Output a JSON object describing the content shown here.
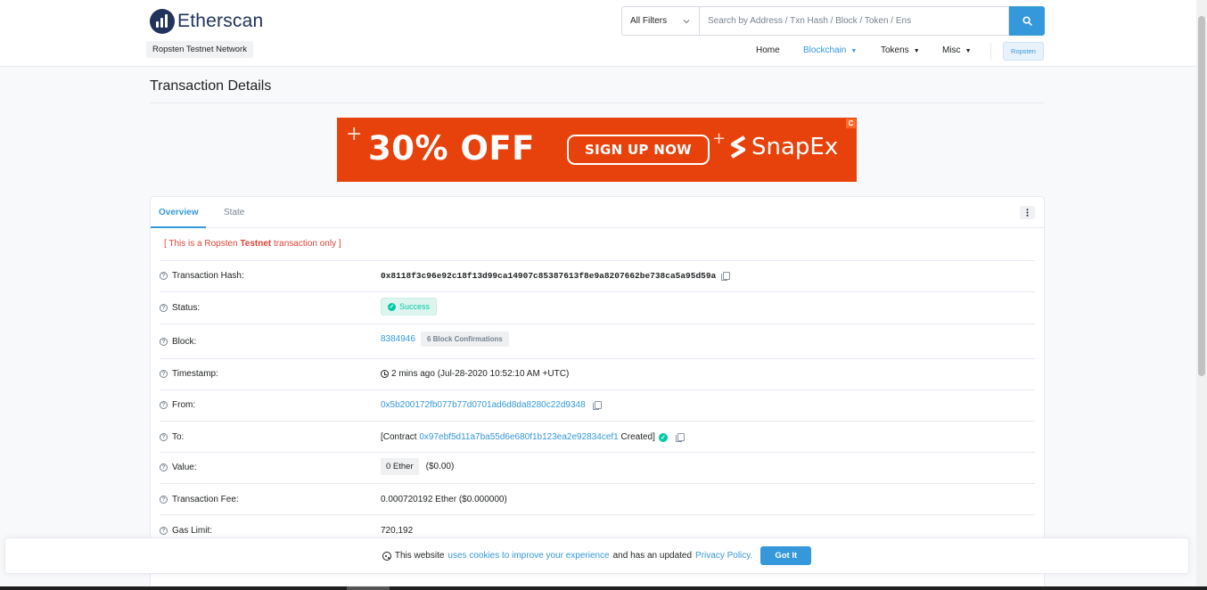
{
  "brand": {
    "name": "Etherscan",
    "network": "Ropsten Testnet Network"
  },
  "search": {
    "filter_label": "All Filters",
    "placeholder": "Search by Address / Txn Hash / Block / Token / Ens"
  },
  "nav": {
    "home": "Home",
    "blockchain": "Blockchain",
    "tokens": "Tokens",
    "misc": "Misc",
    "network_button": "Ropsten"
  },
  "page": {
    "title": "Transaction Details"
  },
  "ad": {
    "offer": "30% OFF",
    "cta": "SIGN UP NOW",
    "brand": "SnapEx",
    "corner": "C",
    "color": "#e8420c"
  },
  "tabs": {
    "overview": "Overview",
    "state": "State"
  },
  "notice": {
    "prefix": "[ This is a Ropsten ",
    "bold": "Testnet",
    "suffix": " transaction only ]"
  },
  "details": {
    "tx_hash": {
      "label": "Transaction Hash:",
      "value": "0x8118f3c96e92c18f13d99ca14907c85387613f8e9a8207662be738ca5a95d59a"
    },
    "status": {
      "label": "Status:",
      "value": "Success"
    },
    "block": {
      "label": "Block:",
      "value": "8384946",
      "confirmations": "6 Block Confirmations"
    },
    "timestamp": {
      "label": "Timestamp:",
      "value": "2 mins ago (Jul-28-2020 10:52:10 AM +UTC)"
    },
    "from": {
      "label": "From:",
      "value": "0x5b200172fb077b77d0701ad6d8da8280c22d9348"
    },
    "to": {
      "label": "To:",
      "prefix": "[Contract ",
      "address": "0x97ebf5d11a7ba55d6e680f1b123ea2e92834cef1",
      "suffix": " Created]"
    },
    "value": {
      "label": "Value:",
      "amount": "0 Ether",
      "usd": "($0.00)"
    },
    "fee": {
      "label": "Transaction Fee:",
      "value": "0.000720192 Ether ($0.000000)"
    },
    "gas_limit": {
      "label": "Gas Limit:",
      "value": "720,192"
    }
  },
  "cookie": {
    "text1": "This website",
    "link1": "uses cookies to improve your experience",
    "text2": "and has an updated",
    "link2": "Privacy Policy.",
    "button": "Got It"
  },
  "colors": {
    "primary": "#3498db",
    "success": "#00c9a7",
    "danger": "#de4437",
    "brand_dark": "#21325b"
  }
}
